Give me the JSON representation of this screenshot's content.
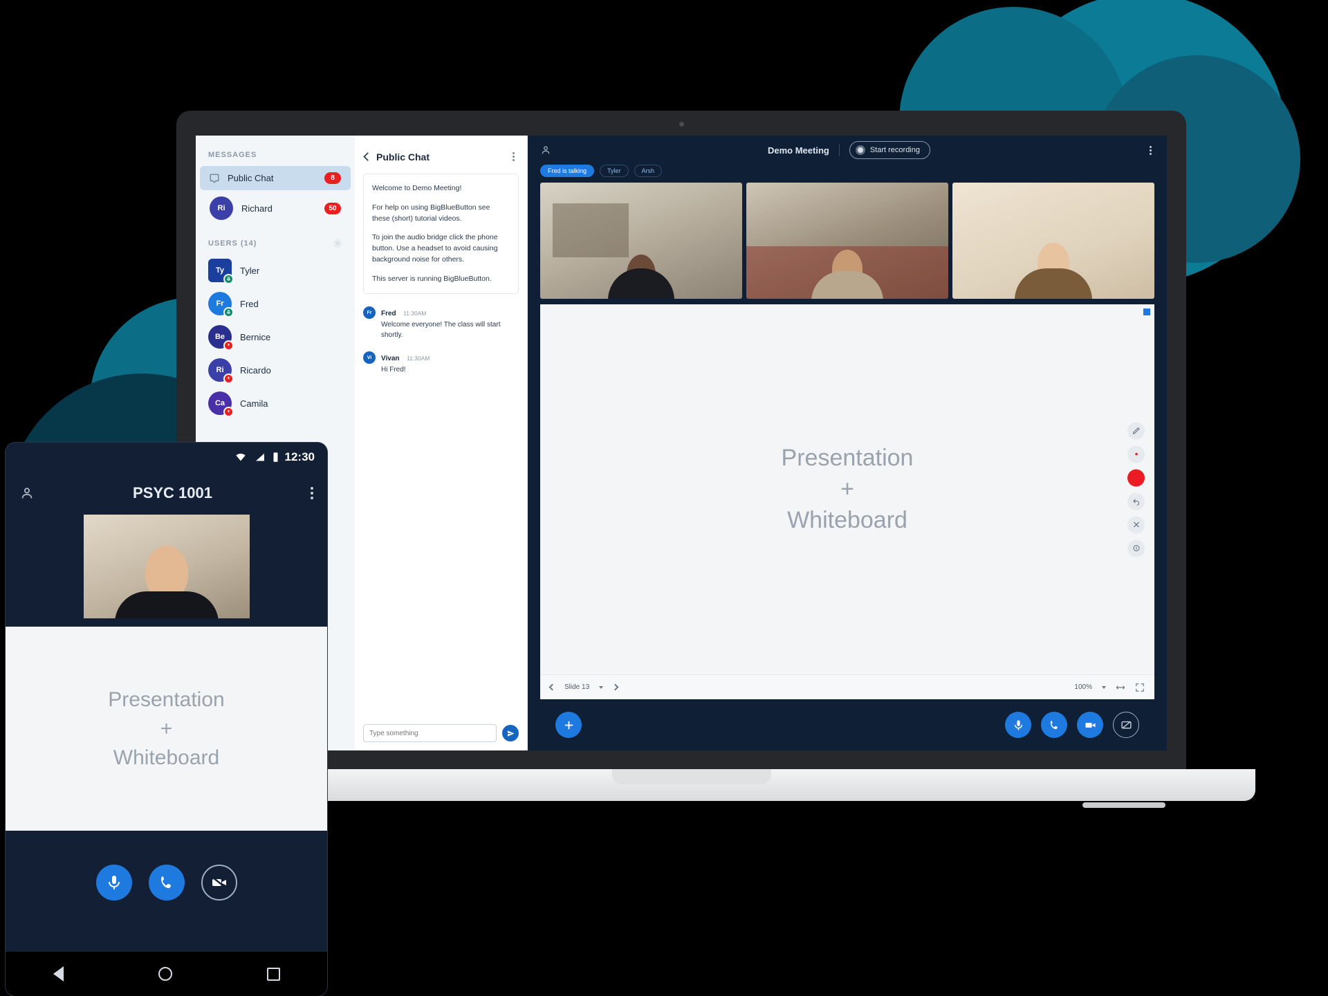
{
  "sidebar": {
    "messages_label": "MESSAGES",
    "chats": [
      {
        "label": "Public Chat",
        "badge": "8",
        "icon": "chat-bubble-icon"
      },
      {
        "label": "Richard",
        "badge": "50",
        "initials": "Ri"
      }
    ],
    "users_label": "USERS (14)",
    "users": [
      {
        "name": "Tyler",
        "initials": "Ty",
        "status": "mic",
        "color": "#1a3f9e",
        "shape": "square"
      },
      {
        "name": "Fred",
        "initials": "Fr",
        "status": "mic",
        "color": "#1f7ae0",
        "shape": "circle"
      },
      {
        "name": "Bernice",
        "initials": "Be",
        "status": "muted",
        "color": "#2a2e8f",
        "shape": "circle"
      },
      {
        "name": "Ricardo",
        "initials": "Ri",
        "status": "muted",
        "color": "#3b3fa8",
        "shape": "circle"
      },
      {
        "name": "Camila",
        "initials": "Ca",
        "status": "muted",
        "color": "#4930a8",
        "shape": "circle"
      }
    ]
  },
  "chat": {
    "title": "Public Chat",
    "welcome": [
      "Welcome to Demo Meeting!",
      "For help on using BigBlueButton see these (short) tutorial videos.",
      "To join the audio bridge click the phone button. Use a headset to avoid causing background noise for others.",
      "This server is running BigBlueButton."
    ],
    "messages": [
      {
        "initials": "Fr",
        "author": "Fred",
        "time": "11:30AM",
        "text": "Welcome everyone! The class will start shortly."
      },
      {
        "initials": "Vi",
        "author": "Vivan",
        "time": "11:30AM",
        "text": "Hi Fred!"
      }
    ],
    "input_value": "",
    "input_placeholder": "Type something",
    "send_icon": "send-icon"
  },
  "meeting": {
    "title": "Demo Meeting",
    "record_label": "Start recording",
    "talking_pills": [
      {
        "label": "Fred is talking",
        "active": true
      },
      {
        "label": "Tyler",
        "active": false
      },
      {
        "label": "Arsh",
        "active": false
      }
    ],
    "whiteboard": {
      "line1": "Presentation",
      "line2": "+",
      "line3": "Whiteboard",
      "slide_label": "Slide 13",
      "zoom_label": "100%",
      "tools": [
        "pencil-icon",
        "thickness-icon",
        "color-swatch-icon",
        "undo-icon",
        "delete-icon",
        "multi-user-icon"
      ]
    },
    "actions": {
      "add_label": "+",
      "buttons": [
        "microphone-icon",
        "phone-icon",
        "video-camera-icon",
        "screen-share-icon"
      ]
    }
  },
  "phone": {
    "time": "12:30",
    "title": "PSYC 1001",
    "whiteboard": {
      "line1": "Presentation",
      "line2": "+",
      "line3": "Whiteboard"
    },
    "buttons": [
      "microphone-icon",
      "phone-icon",
      "video-camera-off-icon"
    ]
  },
  "colors": {
    "accent": "#1f7ae0",
    "meeting_bg": "#0f1f36",
    "badge_red": "#e8201f",
    "mic_green": "#0f8a6a",
    "teal": "#0b7b96"
  }
}
